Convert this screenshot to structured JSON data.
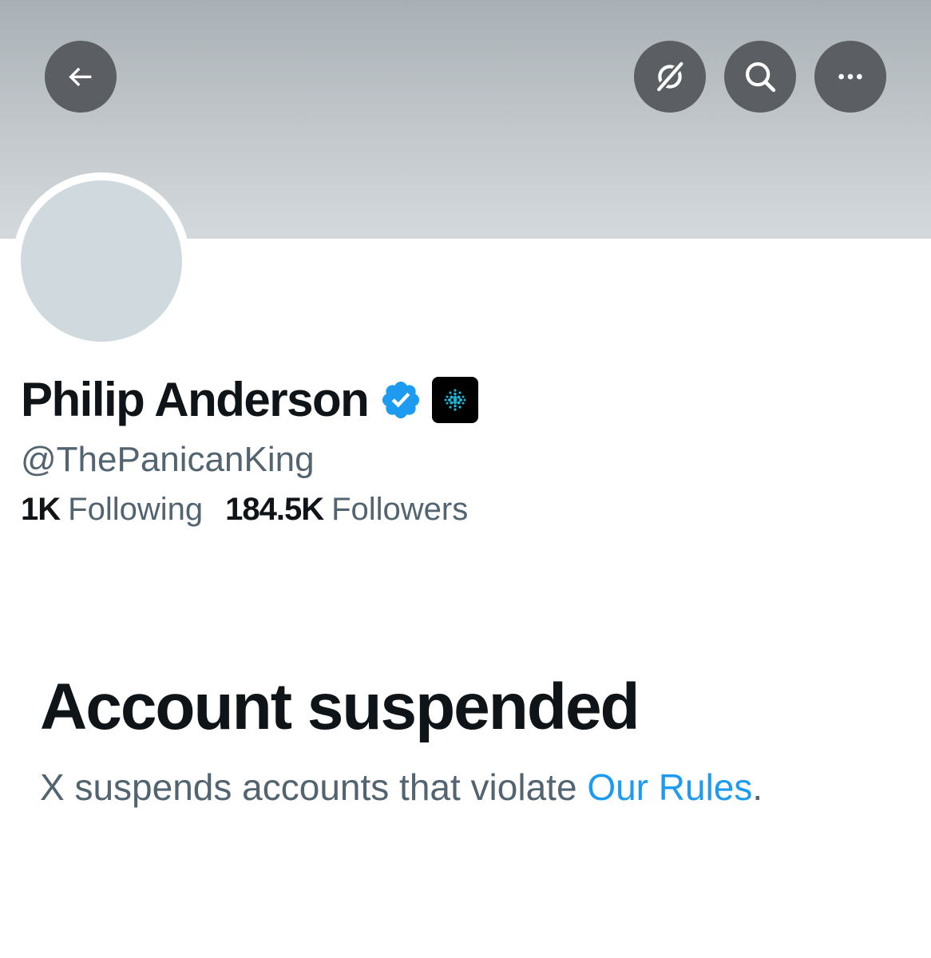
{
  "header": {
    "back_icon": "arrow-left-icon",
    "grok_icon": "grok-slash-icon",
    "search_icon": "search-icon",
    "more_icon": "more-horizontal-icon"
  },
  "profile": {
    "display_name": "Philip Anderson",
    "handle": "@ThePanicanKing",
    "verified_badge": "verified-check-icon",
    "verified_color": "#1d9bf0",
    "affiliate_badge": "affiliate-logo-icon",
    "following_count": "1K",
    "following_label": "Following",
    "followers_count": "184.5K",
    "followers_label": "Followers"
  },
  "notice": {
    "title": "Account suspended",
    "text_before_link": "X suspends accounts that violate ",
    "link_text": "Our Rules",
    "text_after_link": ".",
    "link_color": "#1d9bf0"
  }
}
